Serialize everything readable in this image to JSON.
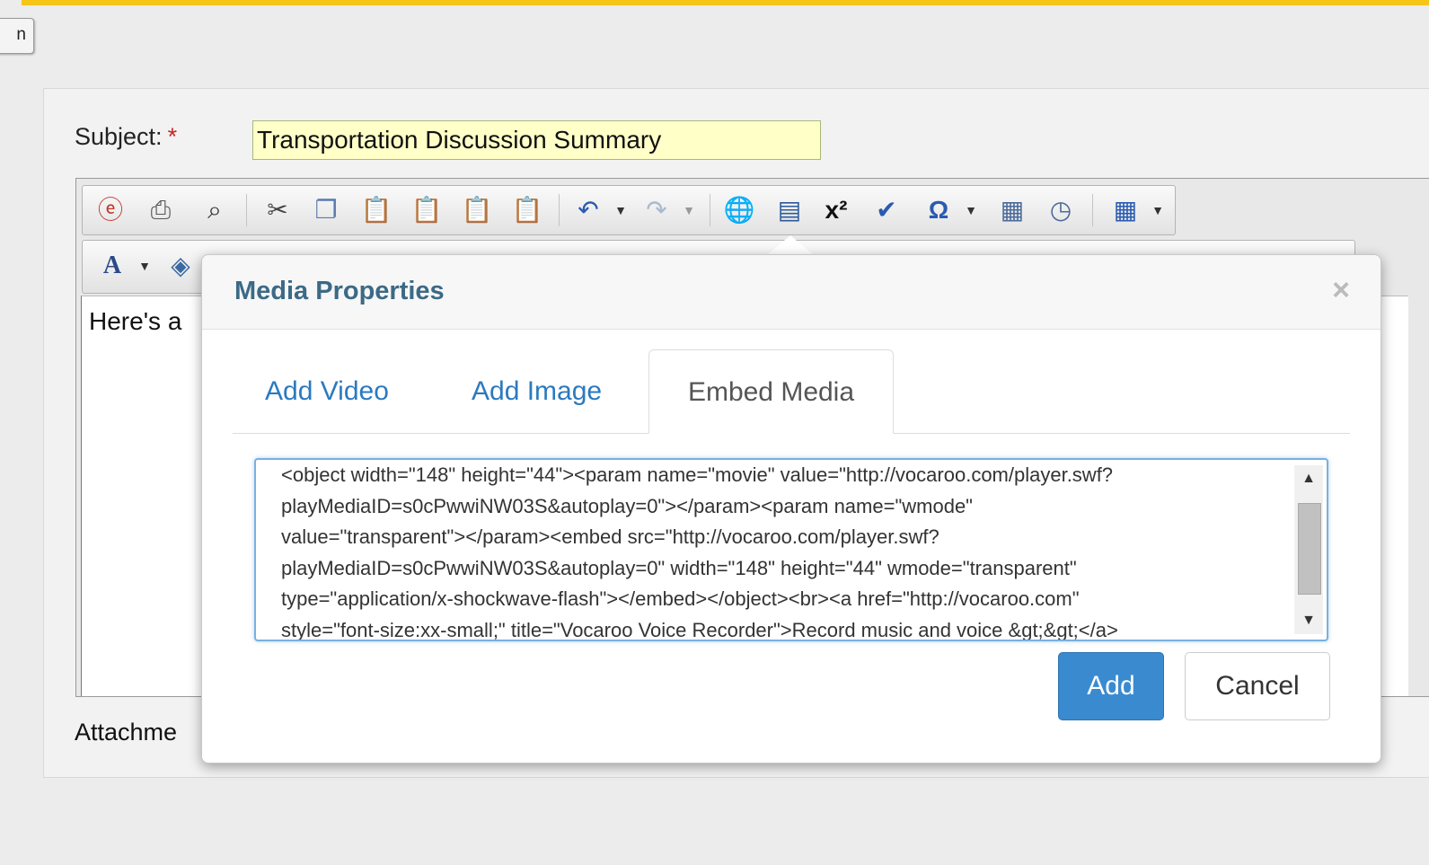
{
  "top_button": {
    "label": "n"
  },
  "form": {
    "subject_label": "Subject:",
    "required_marker": "*",
    "subject_value": "Transportation Discussion Summary",
    "editor_text": "Here's a",
    "attachments_label": "Attachme"
  },
  "toolbar": {
    "icons": [
      "edit-icon",
      "print-icon",
      "find-icon",
      "cut-icon",
      "copy-icon",
      "paste-icon",
      "paste-text-icon",
      "paste-word-icon",
      "paste-special-icon",
      "undo-icon",
      "redo-icon",
      "link-icon",
      "media-icon",
      "superscript-icon",
      "spellcheck-icon",
      "special-character-icon",
      "page-break-icon",
      "time-icon",
      "table-icon"
    ]
  },
  "dialog": {
    "title": "Media Properties",
    "close_symbol": "×",
    "tabs": [
      {
        "label": "Add Video",
        "active": false
      },
      {
        "label": "Add Image",
        "active": false
      },
      {
        "label": "Embed Media",
        "active": true
      }
    ],
    "embed_code": "<object width=\"148\" height=\"44\"><param name=\"movie\" value=\"http://vocaroo.com/player.swf?\nplayMediaID=s0cPwwiNW03S&autoplay=0\"></param><param name=\"wmode\"\nvalue=\"transparent\"></param><embed src=\"http://vocaroo.com/player.swf?\nplayMediaID=s0cPwwiNW03S&autoplay=0\" width=\"148\" height=\"44\" wmode=\"transparent\"\ntype=\"application/x-shockwave-flash\"></embed></object><br><a href=\"http://vocaroo.com\"\nstyle=\"font-size:xx-small;\" title=\"Vocaroo Voice Recorder\">Record music and voice &gt;&gt;</a>",
    "add_label": "Add",
    "cancel_label": "Cancel"
  },
  "colors": {
    "accent_bar": "#f5c518",
    "primary_button": "#3a8ad0",
    "link": "#2a7ac0",
    "dialog_title": "#3c6a86",
    "subject_bg": "#ffffc8"
  }
}
